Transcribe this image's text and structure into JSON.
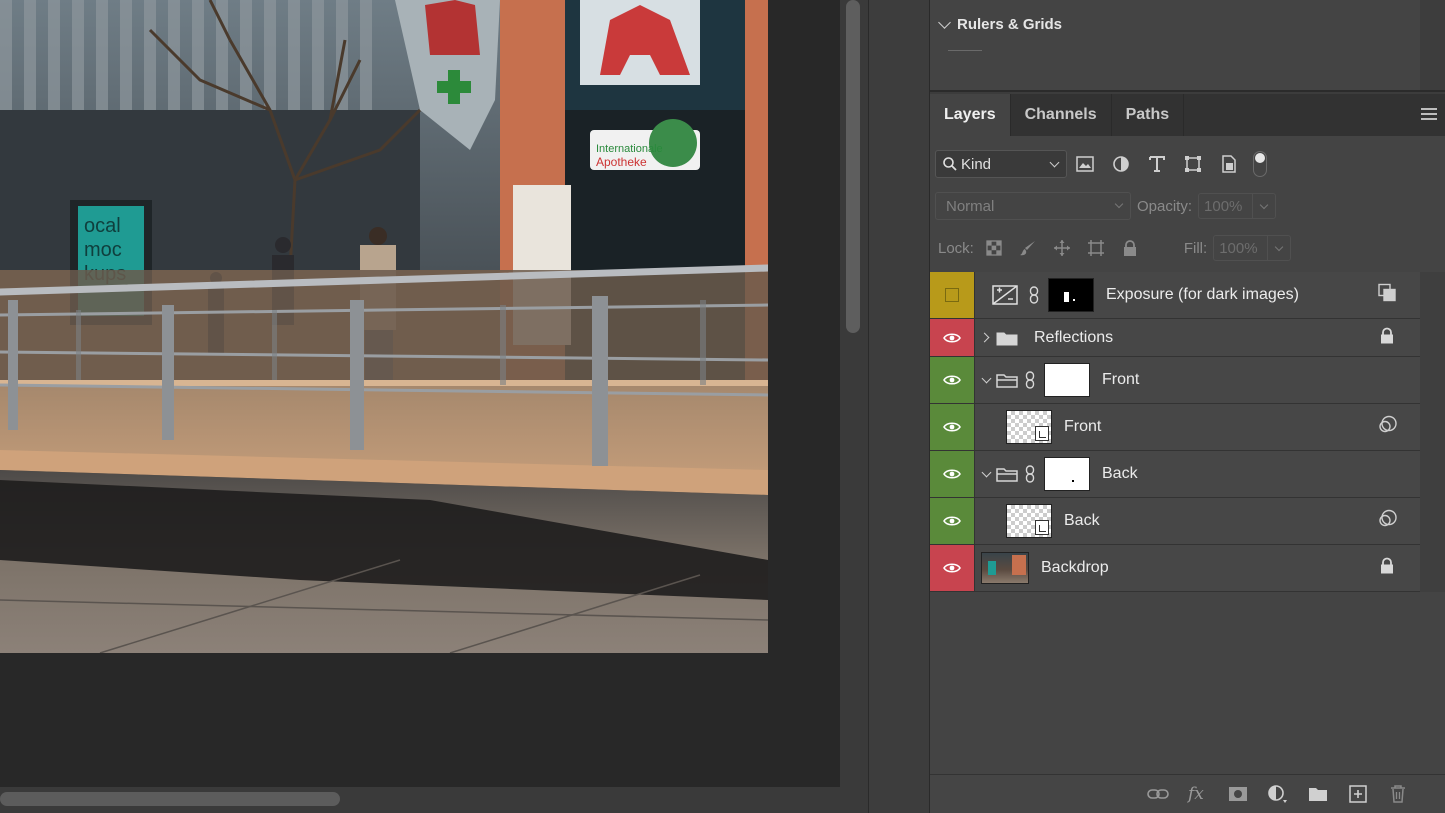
{
  "canvas": {
    "image_description_name": "street-photo"
  },
  "rulers_panel": {
    "title": "Rulers & Grids"
  },
  "layers_tabs": [
    {
      "label": "Layers",
      "active": true
    },
    {
      "label": "Channels",
      "active": false
    },
    {
      "label": "Paths",
      "active": false
    }
  ],
  "filter": {
    "kind_label": "Kind"
  },
  "blend": {
    "mode": "Normal",
    "opacity_label": "Opacity:",
    "opacity_value": "100%"
  },
  "lock": {
    "lock_label": "Lock:",
    "fill_label": "Fill:",
    "fill_value": "100%"
  },
  "layers": [
    {
      "name": "Exposure (for dark images)",
      "visibility_color": "#b89a1a"
    },
    {
      "name": "Reflections",
      "visibility_color": "#c8444f"
    },
    {
      "name": "Front",
      "visibility_color": "#5a8a3a"
    },
    {
      "name": "Front",
      "visibility_color": "#5a8a3a"
    },
    {
      "name": "Back",
      "visibility_color": "#5a8a3a"
    },
    {
      "name": "Back",
      "visibility_color": "#5a8a3a"
    },
    {
      "name": "Backdrop",
      "visibility_color": "#c8444f"
    }
  ],
  "bottom_icons": [
    "link-layers-icon",
    "fx-icon",
    "add-mask-icon",
    "adjustment-layer-icon",
    "new-group-icon",
    "new-layer-icon",
    "trash-icon"
  ],
  "colors": {
    "panel_bg": "#444444",
    "eye_red": "#c8444f",
    "eye_green": "#5a8a3a",
    "eye_yellow": "#b89a1a"
  }
}
